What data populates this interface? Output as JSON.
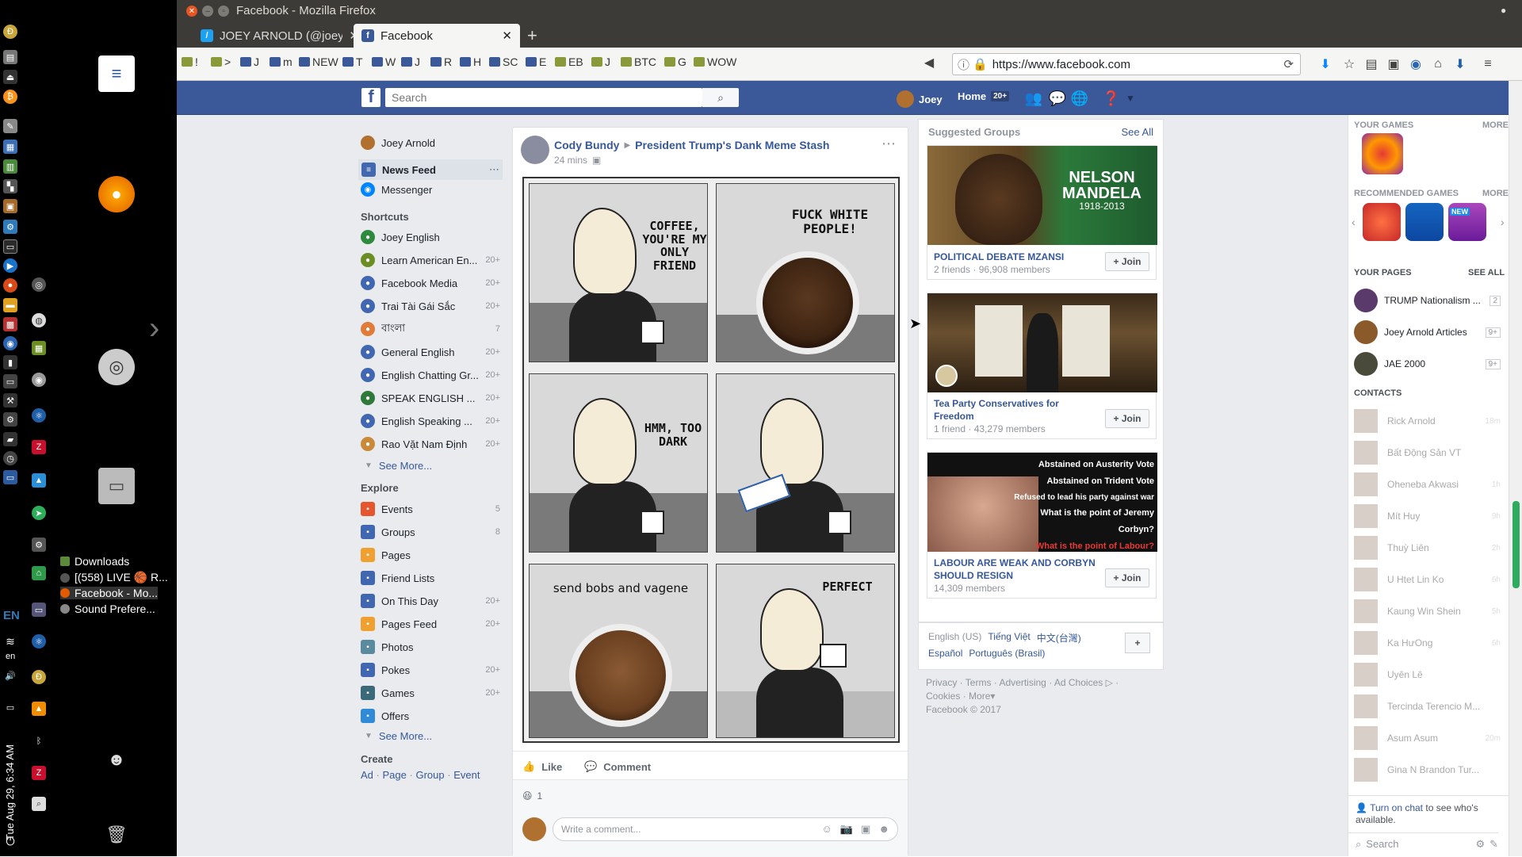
{
  "window": {
    "title": "Facebook - Mozilla Firefox"
  },
  "launcher": {
    "windows": [
      "Downloads",
      "[(558) LIVE 🏀 R...",
      "Facebook - Mo...",
      "Sound Prefere..."
    ],
    "lang": "EN",
    "lang_small": "en",
    "clock": "Tue Aug 29, 6:34 AM"
  },
  "tabs": [
    {
      "label": "JOEY ARNOLD (@joey",
      "active": false
    },
    {
      "label": "Facebook",
      "active": true
    }
  ],
  "bookmarks": [
    "!",
    ">",
    "J",
    "m",
    "NEW",
    "T",
    "W",
    "J",
    "R",
    "H",
    "SC",
    "E",
    "EB",
    "J",
    "BTC",
    "G",
    "WOW"
  ],
  "urlbar": {
    "url": "https://www.facebook.com"
  },
  "fb": {
    "search_placeholder": "Search",
    "user": "Joey",
    "home": "Home",
    "home_badge": "20+"
  },
  "leftnav": {
    "profile": "Joey Arnold",
    "news_feed": "News Feed",
    "messenger": "Messenger",
    "shortcuts_header": "Shortcuts",
    "shortcuts": [
      {
        "label": "Joey English",
        "count": ""
      },
      {
        "label": "Learn American En...",
        "count": "20+"
      },
      {
        "label": "Facebook Media",
        "count": "20+"
      },
      {
        "label": "Trai Tài Gái Sắc",
        "count": "20+"
      },
      {
        "label": "বাংলা",
        "count": "7"
      },
      {
        "label": "General English",
        "count": "20+"
      },
      {
        "label": "English Chatting Gr...",
        "count": "20+"
      },
      {
        "label": "SPEAK ENGLISH ...",
        "count": "20+"
      },
      {
        "label": "English Speaking ...",
        "count": "20+"
      },
      {
        "label": "Rao Vặt Nam Định",
        "count": "20+"
      }
    ],
    "see_more": "See More...",
    "explore_header": "Explore",
    "explore": [
      {
        "label": "Events",
        "count": "5"
      },
      {
        "label": "Groups",
        "count": "8"
      },
      {
        "label": "Pages",
        "count": ""
      },
      {
        "label": "Friend Lists",
        "count": ""
      },
      {
        "label": "On This Day",
        "count": "20+"
      },
      {
        "label": "Pages Feed",
        "count": "20+"
      },
      {
        "label": "Photos",
        "count": ""
      },
      {
        "label": "Pokes",
        "count": "20+"
      },
      {
        "label": "Games",
        "count": "20+"
      },
      {
        "label": "Offers",
        "count": ""
      }
    ],
    "see_more2": "See More...",
    "create_header": "Create",
    "create_links": [
      "Ad",
      "Page",
      "Group",
      "Event"
    ]
  },
  "post": {
    "author": "Cody Bundy",
    "group": "President Trump's Dank Meme Stash",
    "time": "24 mins",
    "panels": [
      "COFFEE, YOU'RE MY ONLY FRIEND",
      "FUCK WHITE PEOPLE!",
      "HMM, TOO DARK",
      "",
      "send bobs and vagene",
      "PERFECT"
    ],
    "like": "Like",
    "comment": "Comment",
    "reactions": "1",
    "comment_placeholder": "Write a comment..."
  },
  "suggested": {
    "title": "Suggested Groups",
    "see_all": "See All",
    "groups": [
      {
        "name": "POLITICAL DEBATE MZANSI",
        "meta": "2 friends · 96,908 members",
        "image_text": [
          "NELSON",
          "MANDELA",
          "1918-2013"
        ]
      },
      {
        "name": "Tea Party Conservatives for Freedom",
        "meta": "1 friend · 43,279 members",
        "image_text": []
      },
      {
        "name": "LABOUR ARE WEAK AND CORBYN SHOULD RESIGN",
        "meta": "14,309 members",
        "image_text": [
          "Abstained on Austerity Vote",
          "Abstained on Trident Vote",
          "Refused to lead his party against war",
          "What is the point of Jeremy Corbyn?",
          "What is the point of Labour?"
        ]
      }
    ],
    "join": "+ Join"
  },
  "footer": {
    "languages": [
      "English (US)",
      "Tiếng Việt",
      "中文(台灣)",
      "Español",
      "Português (Brasil)"
    ],
    "add": "+",
    "links": [
      "Privacy",
      "Terms",
      "Advertising",
      "Ad Choices",
      "Cookies",
      "More"
    ],
    "copyright": "Facebook © 2017"
  },
  "rightbar": {
    "your_games": "YOUR GAMES",
    "more": "MORE",
    "recommended": "RECOMMENDED GAMES",
    "more2": "MORE",
    "new_badge": "NEW",
    "your_pages": "YOUR PAGES",
    "see_all": "SEE ALL",
    "pages": [
      {
        "name": "TRUMP Nationalism ...",
        "badge": "2"
      },
      {
        "name": "Joey Arnold Articles",
        "badge": "9+"
      },
      {
        "name": "JAE 2000",
        "badge": "9+"
      }
    ],
    "contacts_header": "CONTACTS",
    "contacts": [
      {
        "name": "Rick Arnold",
        "time": "18m"
      },
      {
        "name": "Bất Động Sản VT",
        "time": ""
      },
      {
        "name": "Oheneba Akwasi",
        "time": "1h"
      },
      {
        "name": "Mít Huy",
        "time": "9h"
      },
      {
        "name": "Thuỳ Liên",
        "time": "2h"
      },
      {
        "name": "U Htet Lin Ko",
        "time": "6h"
      },
      {
        "name": "Kaung Win Shein",
        "time": "5h"
      },
      {
        "name": "Ka HưOng",
        "time": "6h"
      },
      {
        "name": "Uyên Lê",
        "time": ""
      },
      {
        "name": "Tercinda Terencio M...",
        "time": ""
      },
      {
        "name": "Asum Asum",
        "time": "20m"
      },
      {
        "name": "Gina N Brandon Tur...",
        "time": ""
      }
    ],
    "turn_on_chat": "Turn on chat",
    "chat_note": "to see who's available.",
    "search_placeholder": "Search"
  },
  "colors": {
    "fb_blue": "#3b5998",
    "link": "#365899",
    "bg": "#e9ebee"
  }
}
